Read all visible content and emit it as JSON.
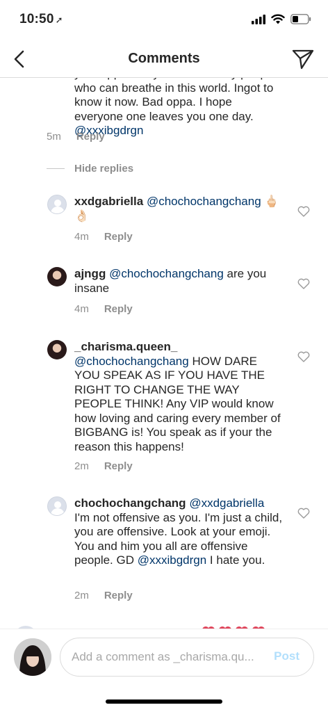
{
  "status_bar": {
    "time": "10:50",
    "location_arrow": "➚"
  },
  "nav": {
    "title": "Comments",
    "back_icon": "chevron-left",
    "send_icon": "paper-plane"
  },
  "comments": [
    {
      "username": "",
      "text_parts": [
        {
          "t": "your oppa and you are the only people who can breathe in this world. Ingot to know it now. Bad oppa. I hope everyone one leaves you one day. ",
          "mention": false
        },
        {
          "t": "@xxxibgdrgn",
          "mention": true
        }
      ],
      "time": "5m",
      "reply": "Reply"
    },
    {
      "username": "xxdgabriella",
      "text_parts": [
        {
          "t": "@chochochangchang",
          "mention": true
        },
        {
          "t": " 🖕🏻👌🏻",
          "mention": false
        }
      ],
      "time": "4m",
      "reply": "Reply"
    },
    {
      "username": "ajngg",
      "text_parts": [
        {
          "t": "@chochochangchang",
          "mention": true
        },
        {
          "t": " are you insane",
          "mention": false
        }
      ],
      "time": "4m",
      "reply": "Reply"
    },
    {
      "username": "_charisma.queen_",
      "text_parts": [
        {
          "t": "@chochochangchang",
          "mention": true
        },
        {
          "t": " HOW DARE YOU SPEAK AS IF YOU HAVE THE RIGHT TO CHANGE THE WAY PEOPLE THINK! Any VIP would know how loving and caring every member of BIGBANG is! You speak as if your the reason this happens!",
          "mention": false
        }
      ],
      "time": "2m",
      "reply": "Reply"
    },
    {
      "username": "chochochangchang",
      "text_parts": [
        {
          "t": "@xxdgabriella",
          "mention": true
        },
        {
          "t": " I'm not offensive as you. I'm just a child, you are offensive. Look at your emoji. You and him you all are offensive people.  GD ",
          "mention": false
        },
        {
          "t": "@xxxibgdrgn",
          "mention": true
        },
        {
          "t": " I hate you.",
          "mention": false
        }
      ],
      "time": "2m",
      "reply": "Reply"
    }
  ],
  "hide_replies": "Hide replies",
  "composer": {
    "placeholder": "Add a comment as _charisma.qu...",
    "post_label": "Post"
  },
  "colors": {
    "mention": "#003569",
    "muted": "#8e8e8e",
    "post_disabled": "#b2dffc"
  }
}
